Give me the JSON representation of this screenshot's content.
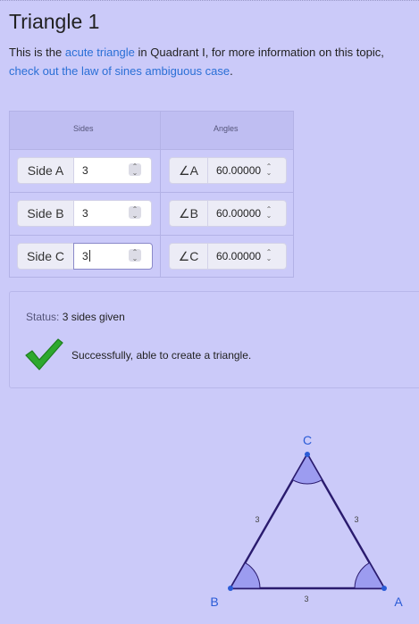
{
  "title": "Triangle 1",
  "intro": {
    "text_1": "This is the ",
    "link_acute": "acute triangle",
    "text_2": " in Quadrant I, for more information on this topic, ",
    "link_law": "check out the law of sines ambiguous case",
    "text_3": "."
  },
  "table": {
    "header_sides": "Sides",
    "header_angles": "Angles",
    "rows": [
      {
        "side_label": "Side A",
        "side_value": "3",
        "angle_label": "∠A",
        "angle_value": "60.00000"
      },
      {
        "side_label": "Side B",
        "side_value": "3",
        "angle_label": "∠B",
        "angle_value": "60.00000"
      },
      {
        "side_label": "Side C",
        "side_value": "3",
        "angle_label": "∠C",
        "angle_value": "60.00000"
      }
    ]
  },
  "status": {
    "label": "Status:",
    "value": "3 sides given",
    "message": "Successfully, able to create a triangle."
  },
  "diagram": {
    "vertex_a": "A",
    "vertex_b": "B",
    "vertex_c": "C",
    "side_ab": "3",
    "side_bc": "3",
    "side_ca": "3"
  },
  "colors": {
    "background": "#cbcaf9",
    "link": "#2a6fd6",
    "vertex_label": "#2a5bd6",
    "triangle_stroke": "#2a1b6e",
    "angle_fill": "#9c9cf0",
    "check": "#2ea82e"
  }
}
